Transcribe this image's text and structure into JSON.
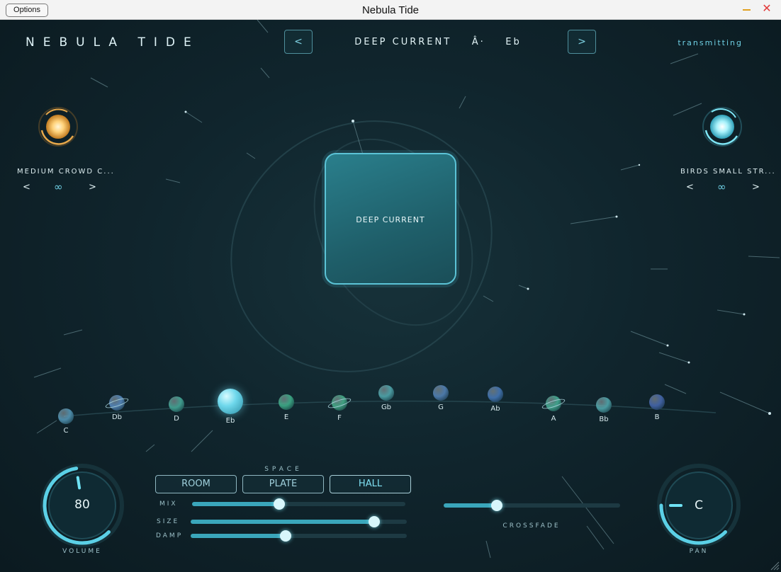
{
  "window": {
    "title": "Nebula Tide",
    "options_label": "Options",
    "minimize_icon": "minimize-icon",
    "close_icon": "close-icon",
    "close_glyph": "✕"
  },
  "header": {
    "brand": "NEBULA TIDE",
    "prev_label": "<",
    "next_label": ">",
    "preset_name": "DEEP CURRENT",
    "preset_marker": "Â·",
    "preset_key": "Eb",
    "status": "transmitting"
  },
  "left_layer": {
    "name": "MEDIUM CROWD C...",
    "prev": "<",
    "loop": "∞",
    "next": ">",
    "orb_icon": "sun-orb-icon",
    "color": "#f4b24a"
  },
  "right_layer": {
    "name": "BIRDS SMALL STR...",
    "prev": "<",
    "loop": "∞",
    "next": ">",
    "orb_icon": "ice-orb-icon",
    "color": "#7ee6f6"
  },
  "center_pad": {
    "label": "DEEP CURRENT"
  },
  "key_selector": {
    "selected": "Eb",
    "keys": [
      {
        "label": "C"
      },
      {
        "label": "Db"
      },
      {
        "label": "D"
      },
      {
        "label": "Eb"
      },
      {
        "label": "E"
      },
      {
        "label": "F"
      },
      {
        "label": "Gb"
      },
      {
        "label": "G"
      },
      {
        "label": "Ab"
      },
      {
        "label": "A"
      },
      {
        "label": "Bb"
      },
      {
        "label": "B"
      }
    ]
  },
  "volume": {
    "label": "VOLUME",
    "value": "80",
    "level": 0.8
  },
  "pan": {
    "label": "PAN",
    "value": "C",
    "level": 0.5
  },
  "space": {
    "title": "SPACE",
    "modes": [
      "ROOM",
      "PLATE",
      "HALL"
    ],
    "selected": "HALL",
    "mix_label": "MIX",
    "mix": 0.41,
    "size_label": "SIZE",
    "size": 0.85,
    "damp_label": "DAMP",
    "damp": 0.44
  },
  "crossfade": {
    "label": "CROSSFADE",
    "value": 0.3
  },
  "colors": {
    "accent": "#5bc3d6",
    "background": "#0e1d24",
    "warm_orb": "#f4b24a",
    "cool_orb": "#7ee6f6"
  }
}
